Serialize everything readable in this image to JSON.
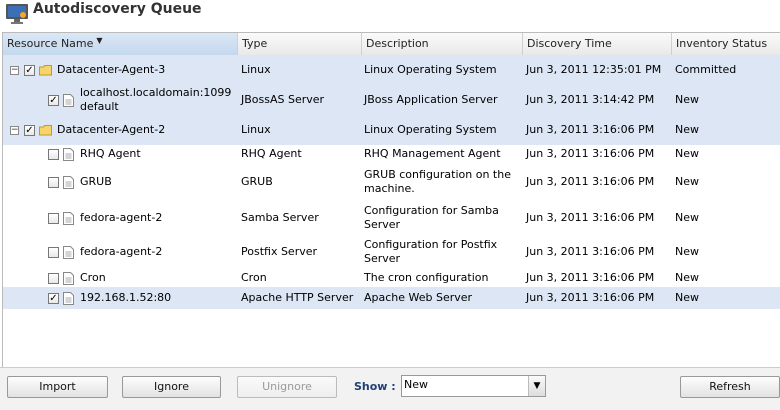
{
  "title": "Autodiscovery Queue",
  "columns": {
    "name": "Resource Name",
    "type": "Type",
    "description": "Description",
    "time": "Discovery Time",
    "status": "Inventory Status"
  },
  "rows": [
    {
      "level": 0,
      "expanded": true,
      "checked": true,
      "icon": "folder-icon",
      "name": "Datacenter-Agent-3",
      "type": "Linux",
      "description": "Linux Operating System",
      "time": "Jun 3, 2011 12:35:01 PM",
      "status": "Committed",
      "selected": true
    },
    {
      "level": 1,
      "checked": true,
      "icon": "file-icon",
      "name": "localhost.localdomain:1099 default",
      "type": "JBossAS Server",
      "description": "JBoss Application Server",
      "time": "Jun 3, 2011 3:14:42 PM",
      "status": "New",
      "selected": true
    },
    {
      "level": 0,
      "expanded": true,
      "checked": true,
      "icon": "folder-icon",
      "name": "Datacenter-Agent-2",
      "type": "Linux",
      "description": "Linux Operating System",
      "time": "Jun 3, 2011 3:16:06 PM",
      "status": "New",
      "selected": true
    },
    {
      "level": 1,
      "checked": false,
      "icon": "file-icon",
      "name": "RHQ Agent",
      "type": "RHQ Agent",
      "description": "RHQ Management Agent",
      "time": "Jun 3, 2011 3:16:06 PM",
      "status": "New",
      "selected": false
    },
    {
      "level": 1,
      "checked": false,
      "icon": "file-icon",
      "name": "GRUB",
      "type": "GRUB",
      "description": "GRUB configuration on the machine.",
      "time": "Jun 3, 2011 3:16:06 PM",
      "status": "New",
      "selected": false
    },
    {
      "level": 1,
      "checked": false,
      "icon": "file-icon",
      "name": "fedora-agent-2",
      "type": "Samba Server",
      "description": "Configuration for Samba Server",
      "time": "Jun 3, 2011 3:16:06 PM",
      "status": "New",
      "selected": false
    },
    {
      "level": 1,
      "checked": false,
      "icon": "file-icon",
      "name": "fedora-agent-2",
      "type": "Postfix Server",
      "description": "Configuration for Postfix Server",
      "time": "Jun 3, 2011 3:16:06 PM",
      "status": "New",
      "selected": false
    },
    {
      "level": 1,
      "checked": false,
      "icon": "file-icon",
      "name": "Cron",
      "type": "Cron",
      "description": "The cron configuration",
      "time": "Jun 3, 2011 3:16:06 PM",
      "status": "New",
      "selected": false
    },
    {
      "level": 1,
      "checked": true,
      "icon": "file-icon",
      "name": "192.168.1.52:80",
      "type": "Apache HTTP Server",
      "description": "Apache Web Server",
      "time": "Jun 3, 2011 3:16:06 PM",
      "status": "New",
      "selected": true
    }
  ],
  "toolbar": {
    "import": "Import",
    "ignore": "Ignore",
    "unignore": "Unignore",
    "show_label": "Show :",
    "show_value": "New",
    "refresh": "Refresh"
  },
  "colors": {
    "selected_row": "#dce6f4",
    "show_label": "#1f3f75"
  }
}
